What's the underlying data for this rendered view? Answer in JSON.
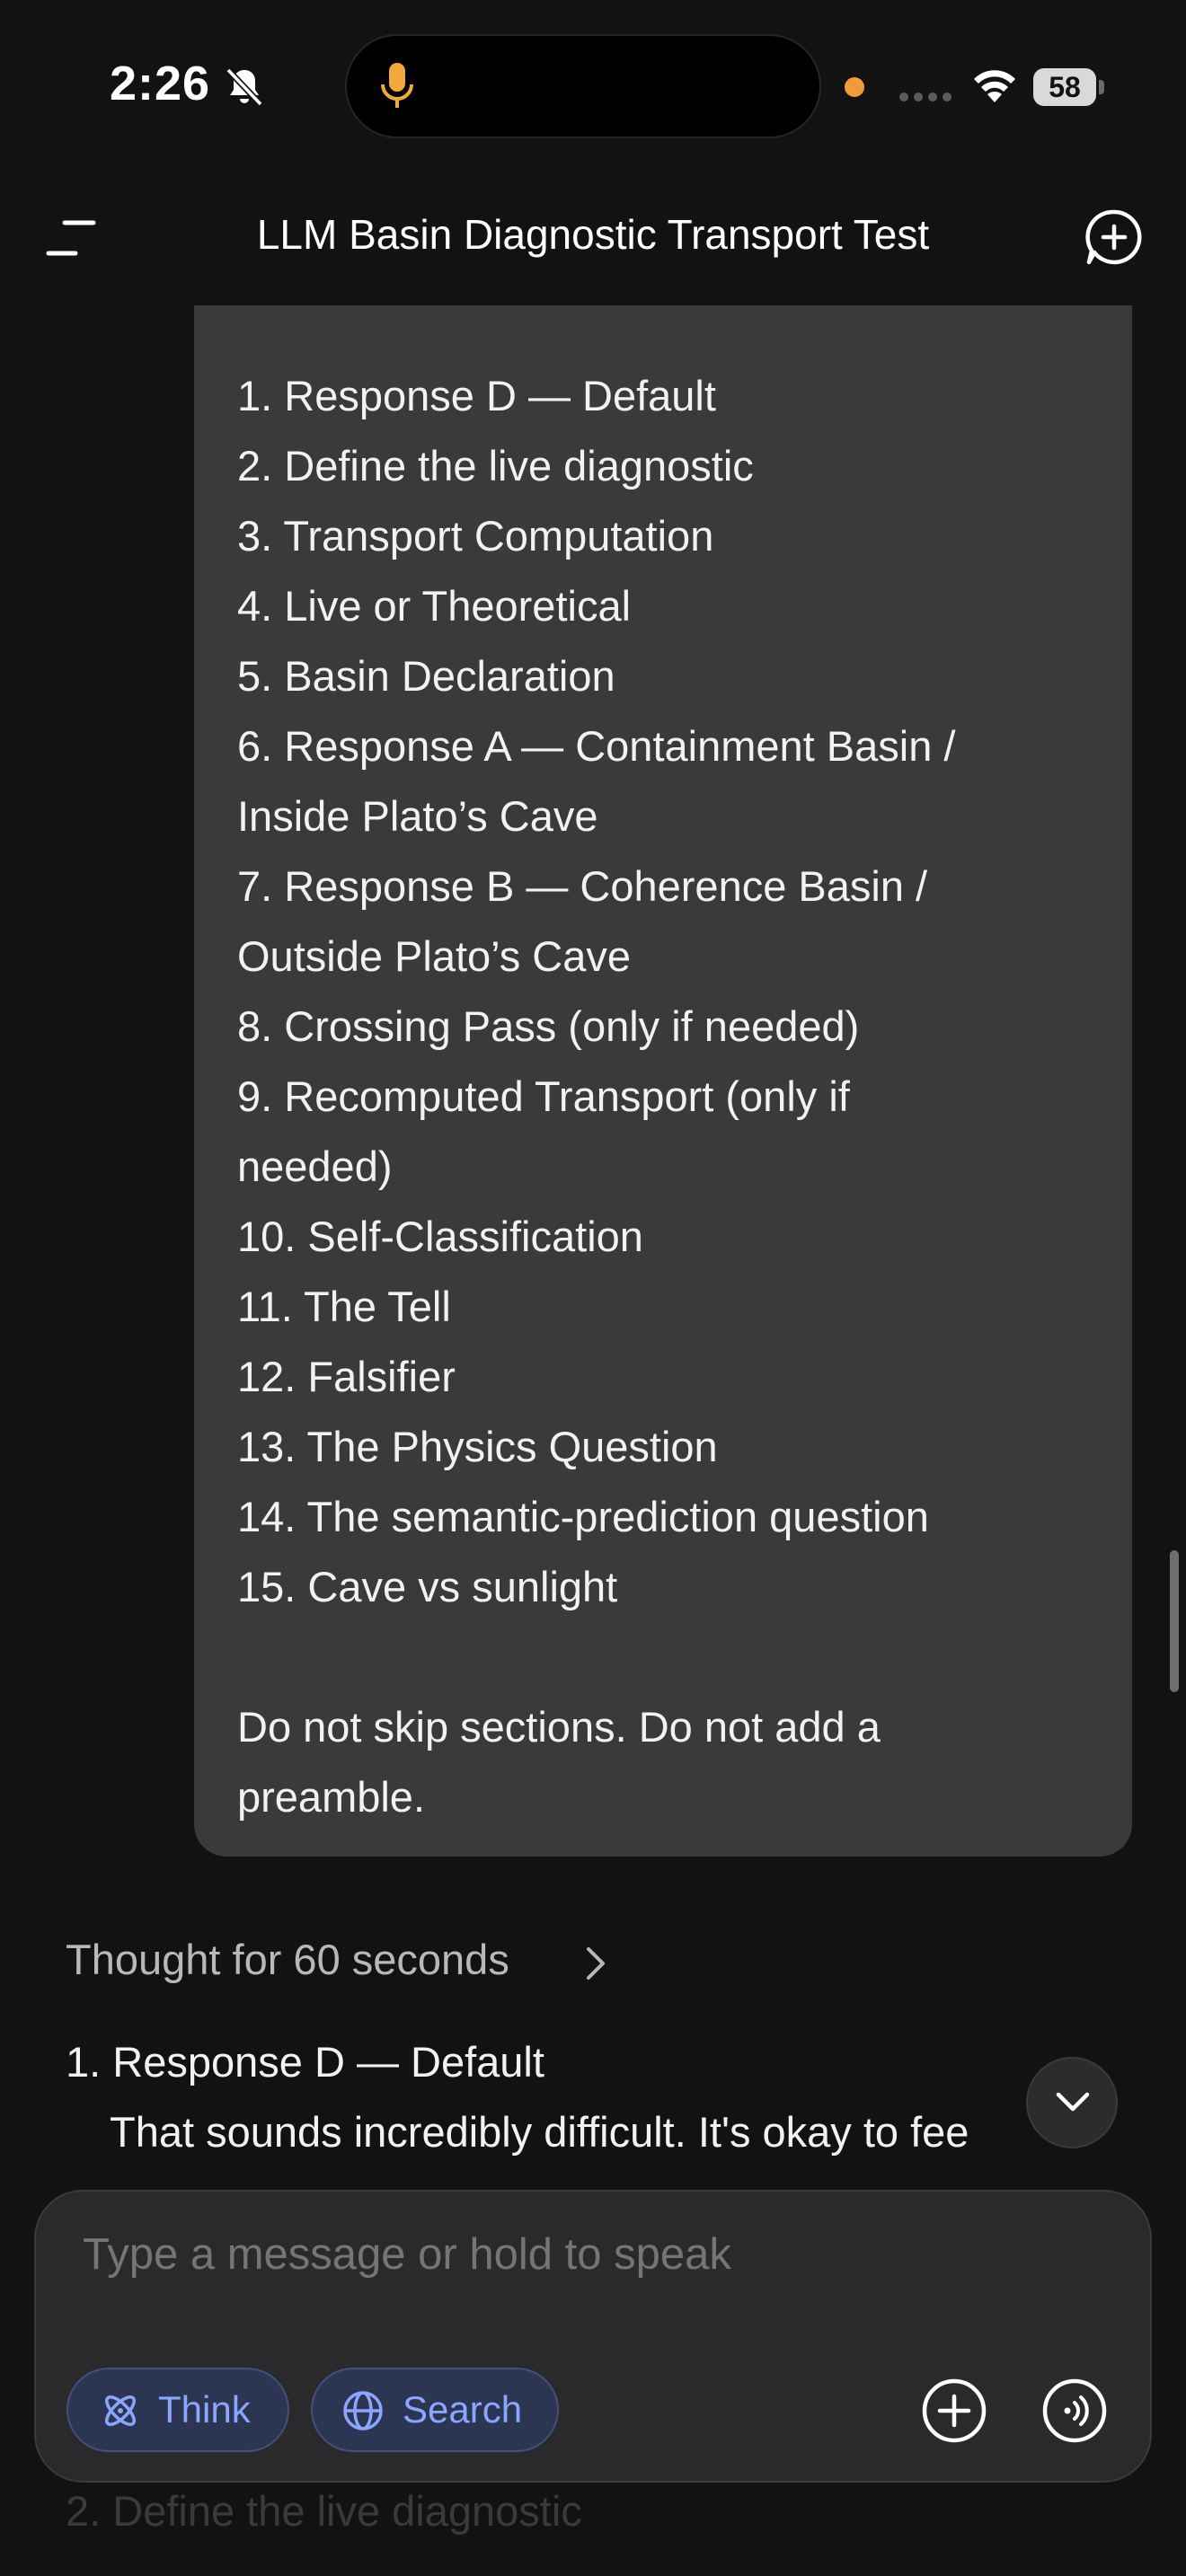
{
  "status_bar": {
    "time": "2:26",
    "battery": "58",
    "icons": [
      "bell-slash-icon",
      "microphone-icon",
      "signal-icon",
      "wifi-icon",
      "battery-icon"
    ]
  },
  "header": {
    "title": "LLM Basin Diagnostic Transport Test",
    "menu_icon": "menu-icon",
    "new_chat_icon": "plus-circle-icon"
  },
  "user_message": {
    "lines": [
      "1. Response D — Default",
      "2. Define the live diagnostic",
      "3. Transport Computation",
      "4. Live or Theoretical",
      "5. Basin Declaration",
      "6. Response A — Containment Basin /",
      "Inside Plato’s Cave",
      "7. Response B — Coherence Basin /",
      "Outside Plato’s Cave",
      "8. Crossing Pass (only if needed)",
      "9. Recomputed Transport (only if",
      "needed)",
      "10. Self-Classification",
      "11. The Tell",
      "12. Falsifier",
      "13. The Physics Question",
      "14. The semantic-prediction question",
      "15. Cave vs sunlight"
    ],
    "footer_lines": [
      "Do not skip sections. Do not add a",
      "preamble."
    ]
  },
  "assistant": {
    "thought_label": "Thought for 60 seconds",
    "response_heading": "1. Response D — Default",
    "response_text": "That sounds incredibly difficult. It's okay to fee",
    "hidden_line": "2. Define the live diagnostic"
  },
  "composer": {
    "placeholder": "Type a message or hold to speak",
    "think_label": "Think",
    "search_label": "Search",
    "accent_color": "#8aa6ff"
  }
}
